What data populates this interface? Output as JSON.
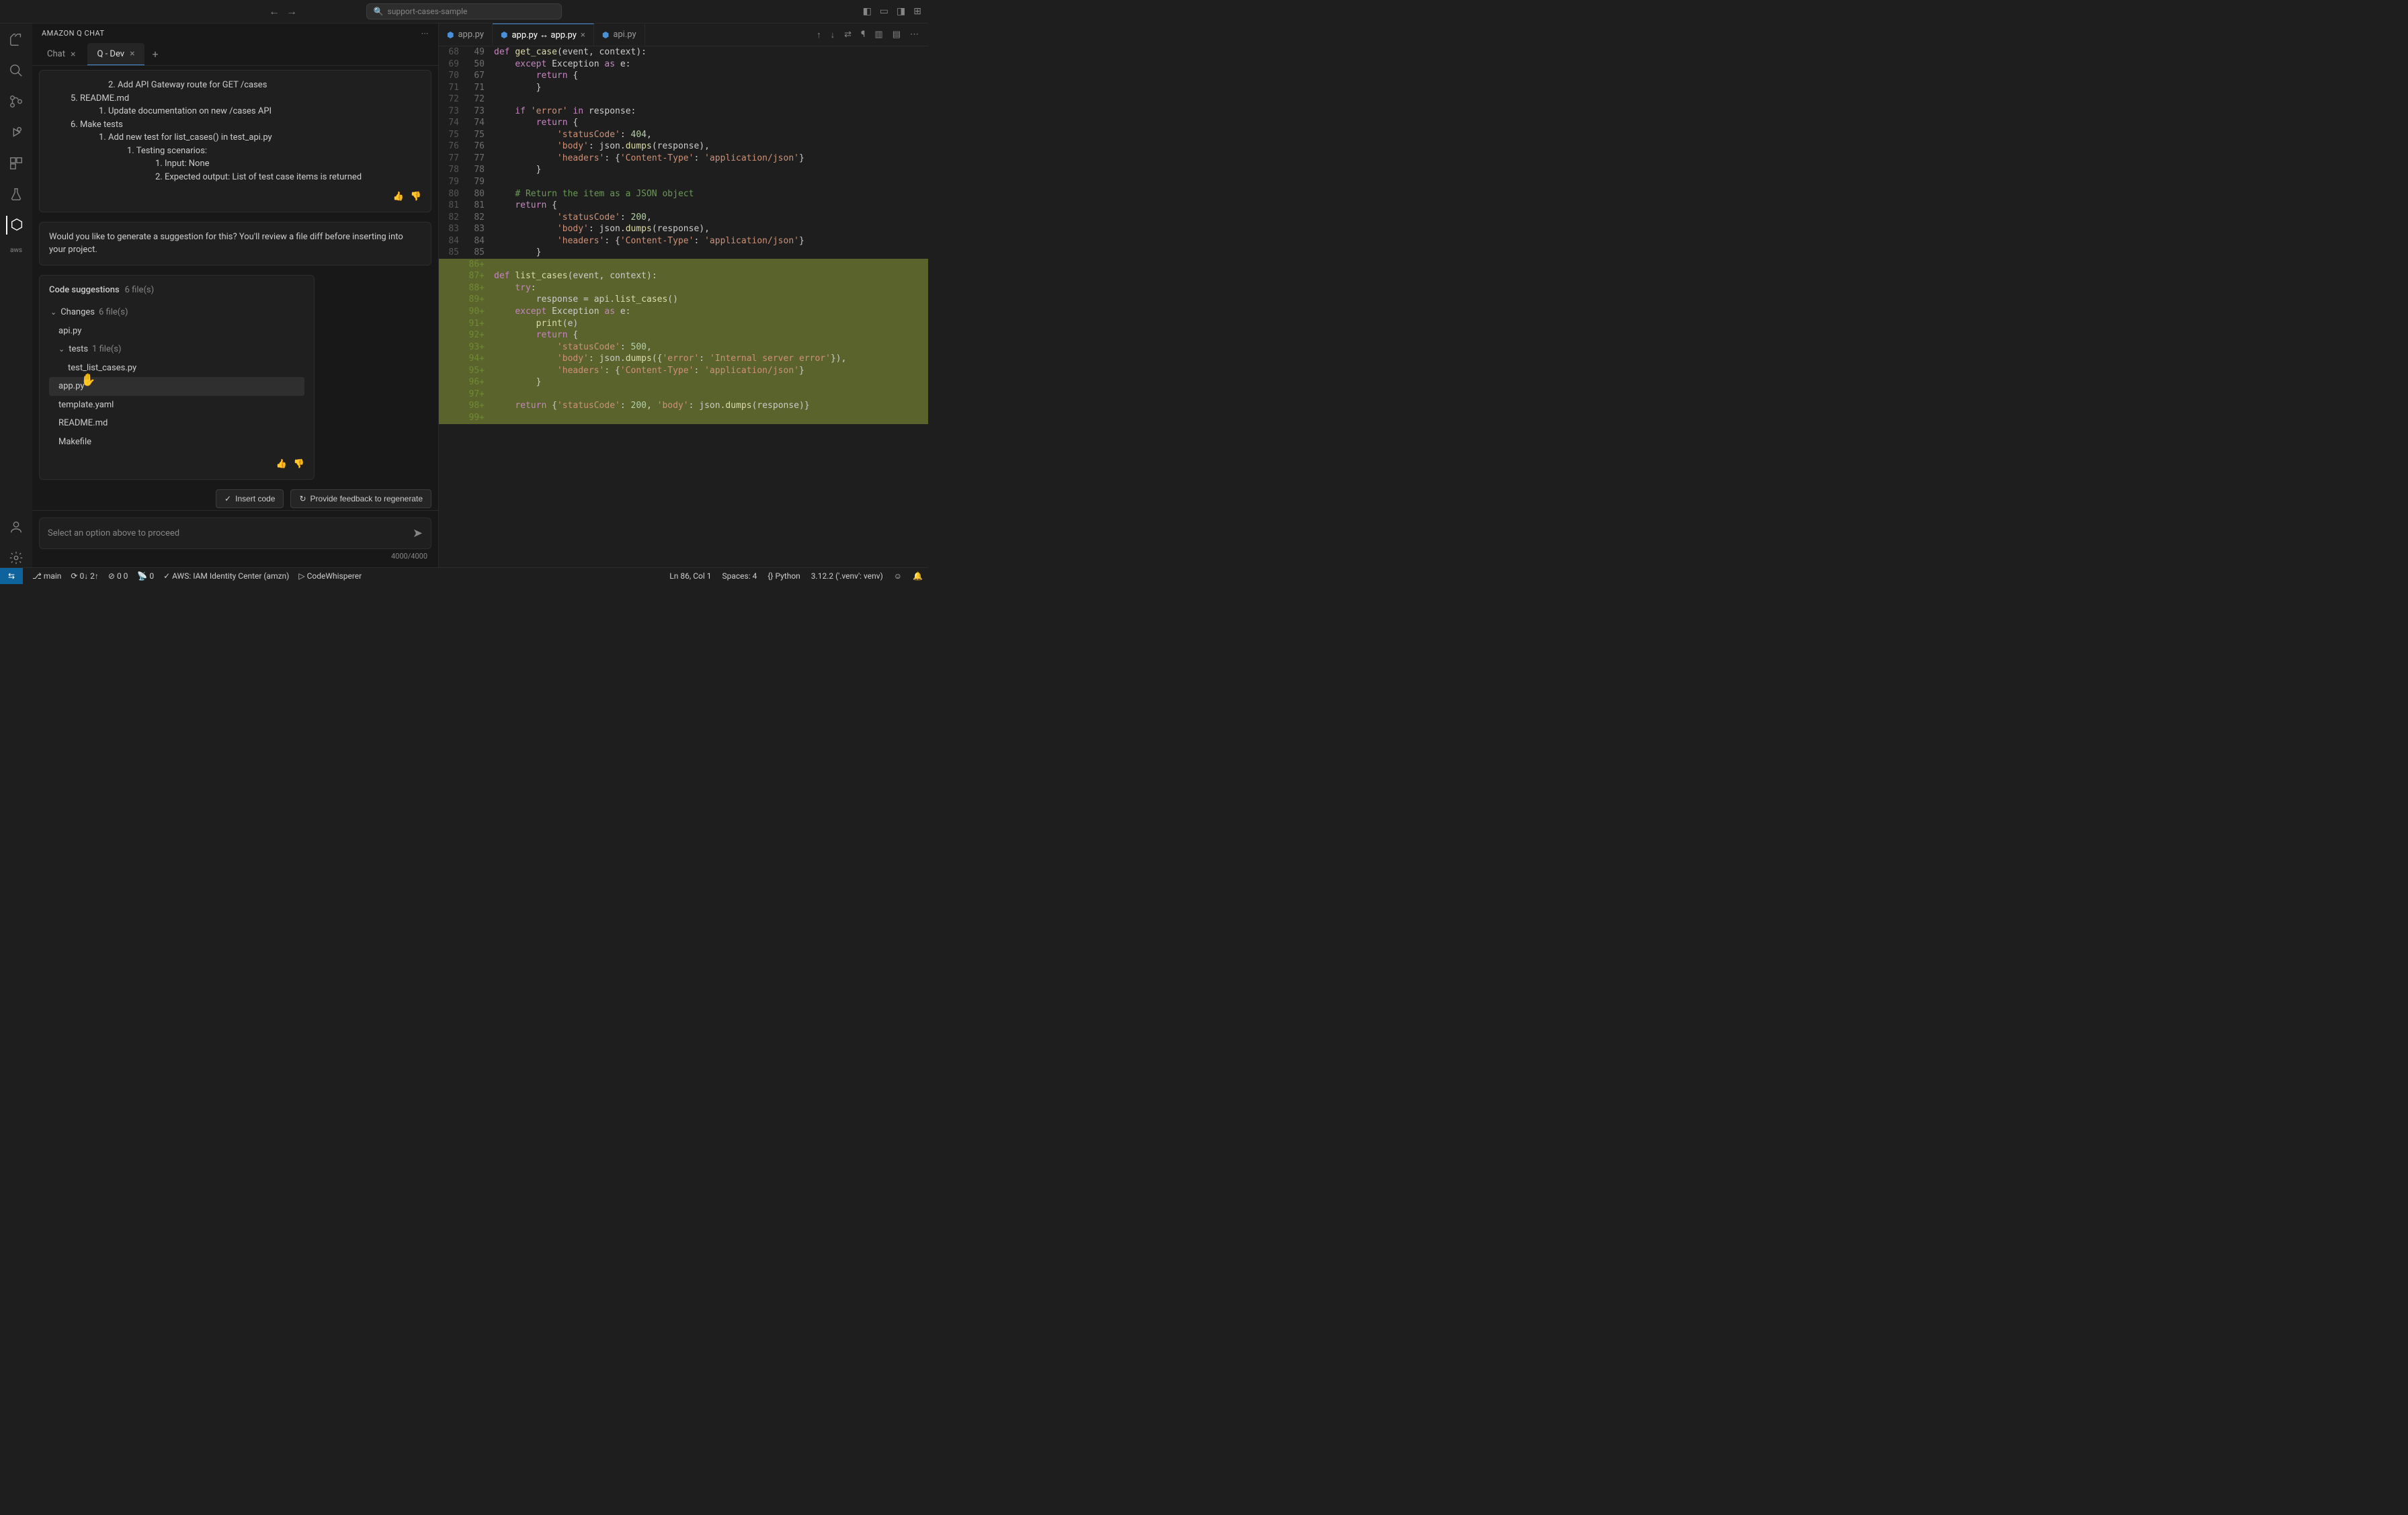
{
  "titlebar": {
    "workspace": "support-cases-sample"
  },
  "panel": {
    "title": "AMAZON Q  CHAT",
    "tabs": [
      {
        "label": "Chat",
        "active": false
      },
      {
        "label": "Q - Dev",
        "active": true
      }
    ]
  },
  "plan": {
    "lines": [
      "2. Add API Gateway route for GET /cases",
      "5. README.md",
      "1. Update documentation on new /cases API",
      "6. Make tests",
      "1. Add new test for list_cases() in test_api.py",
      "1. Testing scenarios:",
      "1. Input: None",
      "2. Expected output: List of test case items is returned"
    ]
  },
  "prompt_card": "Would you like to generate a suggestion for this? You'll review a file diff before inserting into your project.",
  "suggestions": {
    "header": "Code suggestions",
    "file_count": "6 file(s)",
    "changes_label": "Changes",
    "changes_count": "6 file(s)",
    "items": [
      {
        "name": "api.py",
        "indent": 1
      },
      {
        "name": "tests",
        "count": "1 file(s)",
        "indent": 1,
        "folder": true
      },
      {
        "name": "test_list_cases.py",
        "indent": 2
      },
      {
        "name": "app.py",
        "indent": 1,
        "highlight": true
      },
      {
        "name": "template.yaml",
        "indent": 1
      },
      {
        "name": "README.md",
        "indent": 1
      },
      {
        "name": "Makefile",
        "indent": 1
      }
    ]
  },
  "buttons": {
    "insert": "Insert code",
    "regen": "Provide feedback to regenerate"
  },
  "chat_input": {
    "placeholder": "Select an option above to proceed",
    "counter": "4000/4000"
  },
  "editor_tabs": [
    {
      "label": "app.py",
      "active": false
    },
    {
      "label": "app.py ↔ app.py",
      "active": true,
      "close": true
    },
    {
      "label": "api.py",
      "active": false
    }
  ],
  "diff": [
    {
      "o": "68",
      "n": "49",
      "add": false,
      "html": "<span class='tok-kw'>def</span> <span class='tok-fn'>get_case</span>(event, context):"
    },
    {
      "o": "69",
      "n": "50",
      "add": false,
      "html": "    <span class='tok-kw'>except</span> Exception <span class='tok-kw'>as</span> e:"
    },
    {
      "o": "70",
      "n": "67",
      "add": false,
      "html": "        <span class='tok-kw'>return</span> {"
    },
    {
      "o": "71",
      "n": "71",
      "add": false,
      "html": "        }"
    },
    {
      "o": "72",
      "n": "72",
      "add": false,
      "html": ""
    },
    {
      "o": "73",
      "n": "73",
      "add": false,
      "html": "    <span class='tok-kw'>if</span> <span class='tok-str'>'error'</span> <span class='tok-kw'>in</span> response:"
    },
    {
      "o": "74",
      "n": "74",
      "add": false,
      "html": "        <span class='tok-kw'>return</span> {"
    },
    {
      "o": "75",
      "n": "75",
      "add": false,
      "html": "            <span class='tok-str'>'statusCode'</span>: <span class='tok-num'>404</span>,"
    },
    {
      "o": "76",
      "n": "76",
      "add": false,
      "html": "            <span class='tok-str'>'body'</span>: json.<span class='tok-fn'>dumps</span>(response),"
    },
    {
      "o": "77",
      "n": "77",
      "add": false,
      "html": "            <span class='tok-str'>'headers'</span>: {<span class='tok-str'>'Content-Type'</span>: <span class='tok-str'>'application/json'</span>}"
    },
    {
      "o": "78",
      "n": "78",
      "add": false,
      "html": "        }"
    },
    {
      "o": "79",
      "n": "79",
      "add": false,
      "html": ""
    },
    {
      "o": "80",
      "n": "80",
      "add": false,
      "html": "    <span class='tok-cmt'># Return the item as a JSON object</span>"
    },
    {
      "o": "81",
      "n": "81",
      "add": false,
      "html": "    <span class='tok-kw'>return</span> {"
    },
    {
      "o": "82",
      "n": "82",
      "add": false,
      "html": "            <span class='tok-str'>'statusCode'</span>: <span class='tok-num'>200</span>,"
    },
    {
      "o": "83",
      "n": "83",
      "add": false,
      "html": "            <span class='tok-str'>'body'</span>: json.<span class='tok-fn'>dumps</span>(response),"
    },
    {
      "o": "84",
      "n": "84",
      "add": false,
      "html": "            <span class='tok-str'>'headers'</span>: {<span class='tok-str'>'Content-Type'</span>: <span class='tok-str'>'application/json'</span>}"
    },
    {
      "o": "85",
      "n": "85",
      "add": false,
      "html": "        }"
    },
    {
      "o": "",
      "n": "86+",
      "add": true,
      "html": ""
    },
    {
      "o": "",
      "n": "87+",
      "add": true,
      "html": "<span class='tok-kw'>def</span> <span class='tok-fn'>list_cases</span>(event, context):"
    },
    {
      "o": "",
      "n": "88+",
      "add": true,
      "html": "    <span class='tok-kw'>try</span>:"
    },
    {
      "o": "",
      "n": "89+",
      "add": true,
      "html": "        response = api.<span class='tok-fn'>list_cases</span>()"
    },
    {
      "o": "",
      "n": "90+",
      "add": true,
      "html": "    <span class='tok-kw'>except</span> Exception <span class='tok-kw'>as</span> e:"
    },
    {
      "o": "",
      "n": "91+",
      "add": true,
      "html": "        <span class='tok-fn'>print</span>(e)"
    },
    {
      "o": "",
      "n": "92+",
      "add": true,
      "html": "        <span class='tok-kw'>return</span> {"
    },
    {
      "o": "",
      "n": "93+",
      "add": true,
      "html": "            <span class='tok-str'>'statusCode'</span>: <span class='tok-num'>500</span>,"
    },
    {
      "o": "",
      "n": "94+",
      "add": true,
      "html": "            <span class='tok-str'>'body'</span>: json.<span class='tok-fn'>dumps</span>({<span class='tok-str'>'error'</span>: <span class='tok-str'>'Internal server error'</span>}),"
    },
    {
      "o": "",
      "n": "95+",
      "add": true,
      "html": "            <span class='tok-str'>'headers'</span>: {<span class='tok-str'>'Content-Type'</span>: <span class='tok-str'>'application/json'</span>}"
    },
    {
      "o": "",
      "n": "96+",
      "add": true,
      "html": "        }"
    },
    {
      "o": "",
      "n": "97+",
      "add": true,
      "html": ""
    },
    {
      "o": "",
      "n": "98+",
      "add": true,
      "html": "    <span class='tok-kw'>return</span> {<span class='tok-str'>'statusCode'</span>: <span class='tok-num'>200</span>, <span class='tok-str'>'body'</span>: json.<span class='tok-fn'>dumps</span>(response)}"
    },
    {
      "o": "",
      "n": "99+",
      "add": true,
      "html": ""
    }
  ],
  "statusbar": {
    "branch": "main",
    "sync": "0↓ 2↑",
    "problems": "0  0",
    "ports": "0",
    "aws": "AWS: IAM Identity Center (amzn)",
    "whisper": "CodeWhisperer",
    "cursor": "Ln 86, Col 1",
    "spaces": "Spaces: 4",
    "lang": "Python",
    "py": "3.12.2 ('.venv': venv)"
  }
}
